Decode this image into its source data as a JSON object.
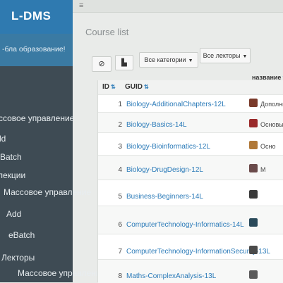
{
  "sidebar": {
    "brand": "L-DMS",
    "welcome": "-бла образование!",
    "items": [
      {
        "label": "ссовое управление"
      },
      {
        "label": "ld"
      },
      {
        "label": "Batch"
      },
      {
        "label": "лекции"
      },
      {
        "label": "Массовое управление"
      },
      {
        "label": "Add"
      },
      {
        "label": "eBatch"
      },
      {
        "label": "Лекторы"
      },
      {
        "label": "Массовое управление"
      }
    ]
  },
  "topbar": {
    "menu_icon": "≡"
  },
  "main": {
    "title": "Course list",
    "toolbar": {
      "disable_icon": "⊘",
      "copy_icon": "▙",
      "categories": "Все категории",
      "lecturers": "Все лекторы"
    },
    "table": {
      "col_id": "ID",
      "col_guid": "GUID",
      "col_name": "название",
      "rows": [
        {
          "id": "1",
          "guid": "Biology-AdditionalChapters-12L",
          "name": "Дополните",
          "thumb": "#7a3a2a"
        },
        {
          "id": "2",
          "guid": "Biology-Basics-14L",
          "name": "Основы",
          "thumb": "#9a2a2a"
        },
        {
          "id": "3",
          "guid": "Biology-Bioinformatics-12L",
          "name": "Осно",
          "thumb": "#b07838"
        },
        {
          "id": "4",
          "guid": "Biology-DrugDesign-12L",
          "name": "М",
          "thumb": "#6a4a4a"
        },
        {
          "id": "5",
          "guid": "Business-Beginners-14L",
          "name": "",
          "thumb": "#3a3a3a"
        },
        {
          "id": "6",
          "guid": "ComputerTechnology-Informatics-14L",
          "name": "",
          "thumb": "#2a4a5a"
        },
        {
          "id": "7",
          "guid": "ComputerTechnology-InformationSecurity-13L",
          "name": "",
          "thumb": "#4a4a4a"
        },
        {
          "id": "8",
          "guid": "Maths-ComplexAnalysis-13L",
          "name": "",
          "thumb": "#5a5a5a"
        }
      ]
    }
  }
}
